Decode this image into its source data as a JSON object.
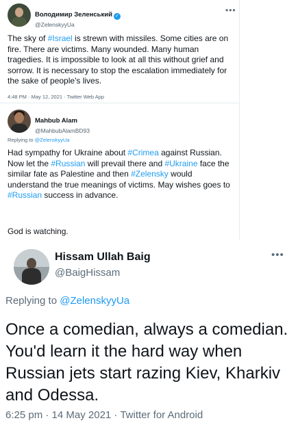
{
  "tweet": {
    "author_name": "Володимир Зеленський",
    "author_handle": "@ZelenskyyUa",
    "text_parts": [
      "The sky of ",
      "#Israel",
      " is strewn with missiles. Some cities are on fire. There are victims. Many wounded. Many human tragedies. It is impossible to look at all this without grief and sorrow. It is necessary to stop the escalation immediately for the sake of people's lives."
    ],
    "meta": "4:48 PM · May 12, 2021 · Twitter Web App",
    "more_icon": "more-horizontal-icon",
    "verified_icon": "verified-badge-icon"
  },
  "reply1": {
    "author_name": "Mahbub Alam",
    "author_handle": "@MahbubAlamBD93",
    "replying_prefix": "Replying to ",
    "replying_handle": "@ZelenskyyUa",
    "text_parts": [
      "Had sympathy for Ukraine about ",
      "#Crimea",
      " against Russian. Now let the ",
      "#Russian",
      " will prevail there and ",
      "#Ukraine",
      " face the similar fate as Palestine and then ",
      "#Zelensky",
      " would understand the true meanings of victims. May wishes goes to ",
      "#Russian",
      " success in advance."
    ],
    "closing": "God is watching."
  },
  "reply2": {
    "author_name": "Hissam Ullah Baig",
    "author_handle": "@BaigHissam",
    "replying_prefix": "Replying to ",
    "replying_handle": "@ZelenskyyUa",
    "text": "Once a comedian, always a comedian. You'd learn it the hard way when Russian jets start razing Kiev, Kharkiv and Odessa.",
    "meta": "6:25 pm · 14 May 2021 · Twitter for Android",
    "more_icon": "more-horizontal-icon"
  },
  "colors": {
    "link": "#1d9bf0",
    "text": "#0f1419",
    "secondary": "#536471"
  }
}
